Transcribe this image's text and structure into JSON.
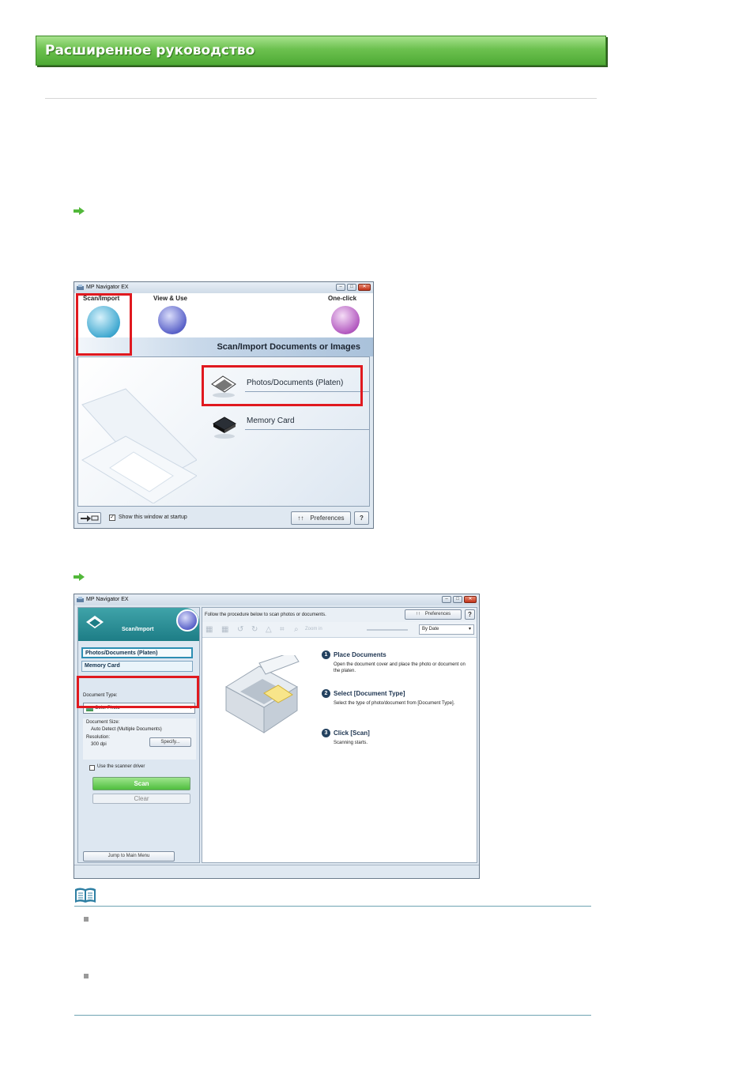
{
  "header": {
    "title": "Расширенное руководство"
  },
  "window1": {
    "title": "MP Navigator EX",
    "modes": [
      "Scan/Import",
      "View & Use",
      "One-click"
    ],
    "band_title": "Scan/Import Documents or Images",
    "items": [
      "Photos/Documents (Platen)",
      "Memory Card"
    ],
    "startup_checkbox": "Show this window at startup",
    "preferences": "Preferences",
    "help": "?"
  },
  "window2": {
    "title": "MP Navigator EX",
    "tab": "Scan/Import",
    "options": [
      "Photos/Documents (Platen)",
      "Memory Card"
    ],
    "doc_type_label": "Document Type:",
    "doc_type_value": "Color Photo",
    "doc_size_label": "Document Size:",
    "doc_size_value": "Auto Detect (Multiple Documents)",
    "resolution_label": "Resolution:",
    "resolution_value": "300 dpi",
    "specify": "Specify...",
    "scanner_driver": "Use the scanner driver",
    "scan": "Scan",
    "clear": "Clear",
    "jump": "Jump to Main Menu",
    "instruction": "Follow the procedure below to scan photos or documents.",
    "preferences": "Preferences",
    "help": "?",
    "zoom": "Zoom in",
    "sort": "By Date",
    "steps": [
      {
        "num": "1",
        "title": "Place Documents",
        "desc": "Open the document cover and place the photo or document on the platen."
      },
      {
        "num": "2",
        "title": "Select [Document Type]",
        "desc": "Select the type of photo/document from [Document Type]."
      },
      {
        "num": "3",
        "title": "Click [Scan]",
        "desc": "Scanning starts."
      }
    ]
  },
  "colors": {
    "banner": "#5ab43f",
    "highlight": "#e0191f",
    "note_rule": "#6fa3b2"
  }
}
